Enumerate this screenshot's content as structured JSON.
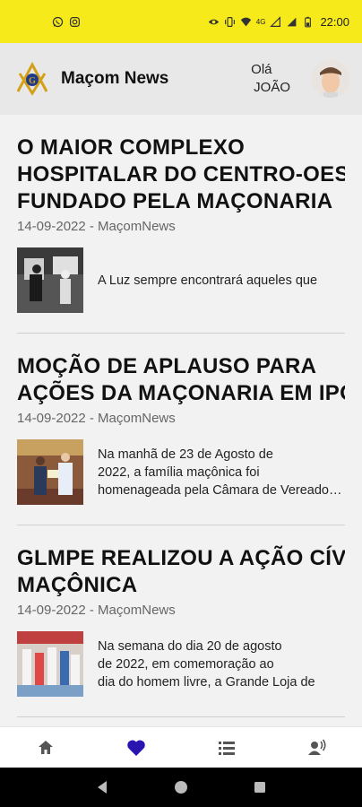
{
  "status_bar": {
    "time": "22:00",
    "icons": [
      "whatsapp-icon",
      "instagram-icon",
      "eye-icon",
      "vibrate-icon",
      "wifi-icon",
      "signal-icon",
      "battery-icon"
    ],
    "network_label": "4G"
  },
  "header": {
    "app_title": "Maçom News",
    "greeting": "Olá",
    "user_name": "JOÃO"
  },
  "articles": [
    {
      "title_lines": [
        "O MAIOR COMPLEXO",
        "HOSPITALAR DO CENTRO-OESTE",
        "FUNDADO PELA MAÇONARIA"
      ],
      "meta": "14-09-2022 - MaçomNews",
      "excerpt_lines": [
        "A Luz sempre encontrará aqueles que"
      ]
    },
    {
      "title_lines": [
        "MOÇÃO DE APLAUSO PARA",
        "AÇÕES DA MAÇONARIA EM IPOJUCA"
      ],
      "meta": "14-09-2022 - MaçomNews",
      "excerpt_lines": [
        "Na manhã de 23 de Agosto de",
        "2022, a família maçônica foi",
        "homenageada pela Câmara de Vereadores"
      ]
    },
    {
      "title_lines": [
        "GLMPE REALIZOU A AÇÃO CÍVICA",
        "MAÇÔNICA"
      ],
      "meta": "14-09-2022 - MaçomNews",
      "excerpt_lines": [
        "Na semana do dia 20 de agosto",
        "de 2022, em comemoração ao",
        "dia do homem livre, a Grande Loja de"
      ]
    }
  ],
  "bottom_nav": [
    {
      "icon": "home-icon",
      "active": false
    },
    {
      "icon": "heart-icon",
      "active": true
    },
    {
      "icon": "list-icon",
      "active": false
    },
    {
      "icon": "voice-icon",
      "active": false
    }
  ],
  "colors": {
    "status_bar": "#f7ea1a",
    "header_bg": "#e8e8e8",
    "accent": "#2a14b0",
    "logo_gold": "#d4a017",
    "logo_blue": "#1e3a8a"
  }
}
